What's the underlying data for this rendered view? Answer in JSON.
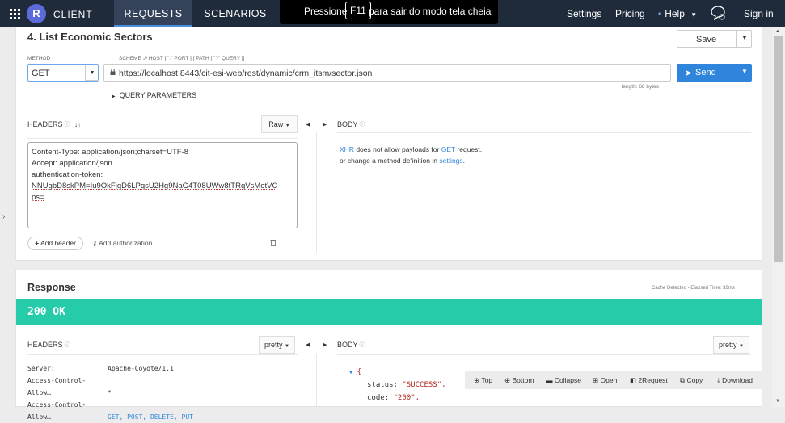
{
  "topbar": {
    "brand_letter": "R",
    "brand": "CLIENT",
    "tabs": [
      {
        "label": "REQUESTS"
      },
      {
        "label": "SCENARIOS"
      }
    ],
    "fullscreen_notice": {
      "text_before": "Pressione",
      "key": "F11",
      "text_after": "para sair do modo tela cheia"
    },
    "settings": "Settings",
    "pricing": "Pricing",
    "help": "Help",
    "sign_in": "Sign in"
  },
  "request": {
    "title": "4. List Economic Sectors",
    "save_label": "Save",
    "method_label": "METHOD",
    "method": "GET",
    "url_hint": "SCHEME :// HOST [ \":\" PORT ] [ PATH [ \"?\" QUERY ]]",
    "url": "https://localhost:8443/cit-esi-web/rest/dynamic/crm_itsm/sector.json",
    "length": "length: 68 bytes",
    "send_label": "Send",
    "query_params": "QUERY PARAMETERS",
    "headers_label": "HEADERS",
    "raw_label": "Raw",
    "body_label": "BODY",
    "headers_lines": [
      "Content-Type: application/json;charset=UTF-8",
      "Accept: application/json",
      "authentication-token:",
      "NNUgbD8skPM=Iu9OkFjqD6LPqsU2Hg9NaG4T08UWw8tTRqVsMotVC",
      "ps="
    ],
    "body_msg": {
      "xhr": "XHR",
      "line1_mid": "does not allow payloads for",
      "get": "GET",
      "line1_end": "request.",
      "line2_start": "or change a method definition in",
      "settings": "settings",
      "line2_end": "."
    },
    "add_header": "Add header",
    "add_authorization": "Add authorization"
  },
  "response": {
    "title": "Response",
    "meta": "Cache Detected - Elapsed Time: 32ms",
    "status": "200 OK",
    "headers_label": "HEADERS",
    "pretty_label": "pretty",
    "body_label": "BODY",
    "headers": [
      {
        "key": "Server:",
        "value": "Apache-Coyote/1.1"
      },
      {
        "key": "Access-Control-Allow…",
        "value": "*"
      },
      {
        "key": "Access-Control-Allow…",
        "value": "GET, POST, DELETE, PUT"
      }
    ],
    "json_lines": {
      "open": "{",
      "status_key": "status:",
      "status_val": "\"SUCCESS\",",
      "code_key": "code:",
      "code_val": "\"200\","
    },
    "toolbar": {
      "top": "Top",
      "bottom": "Bottom",
      "collapse": "Collapse",
      "open": "Open",
      "request": "2Request",
      "copy": "Copy",
      "download": "Download"
    }
  },
  "colors": {
    "topbar": "#1f2b3b",
    "accent": "#2f84dc",
    "status_bar": "#26cbaa"
  }
}
